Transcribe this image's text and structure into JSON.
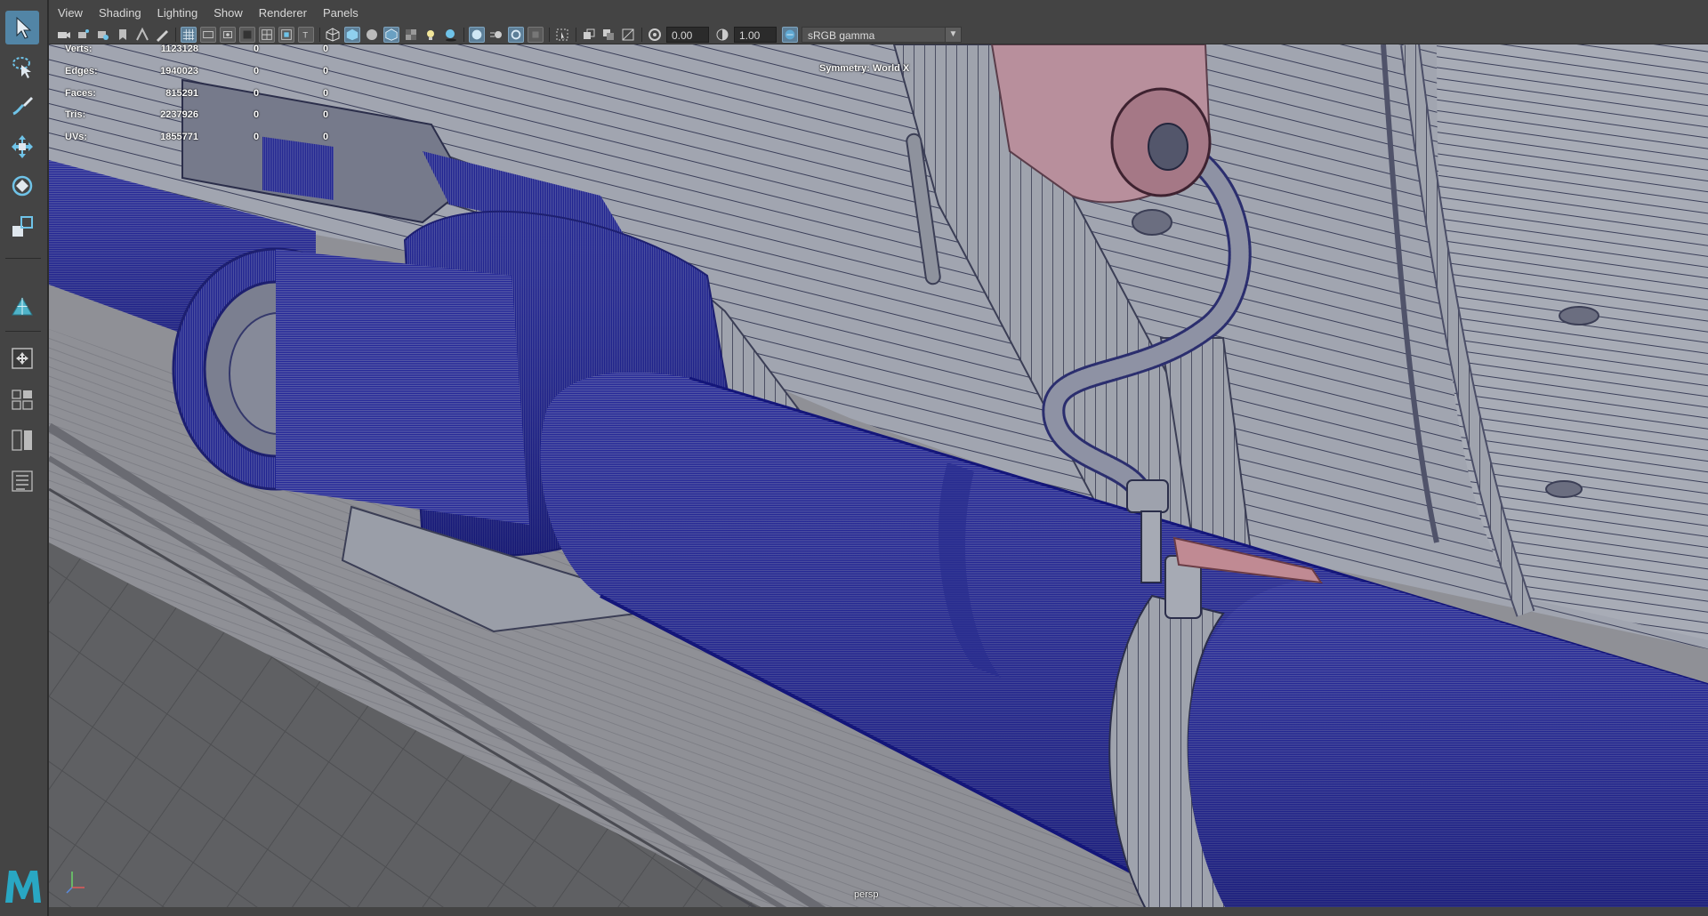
{
  "menubar": {
    "items": [
      "View",
      "Shading",
      "Lighting",
      "Show",
      "Renderer",
      "Panels"
    ]
  },
  "iconbar": {
    "exposure_value": "0.00",
    "gamma_value": "1.00",
    "color_space": "sRGB gamma"
  },
  "hud": {
    "stats": [
      {
        "label": "Verts:",
        "value": "1123128",
        "selected": "0",
        "components": "0"
      },
      {
        "label": "Edges:",
        "value": "1940023",
        "selected": "0",
        "components": "0"
      },
      {
        "label": "Faces:",
        "value": "815291",
        "selected": "0",
        "components": "0"
      },
      {
        "label": "Tris:",
        "value": "2237926",
        "selected": "0",
        "components": "0"
      },
      {
        "label": "UVs:",
        "value": "1855771",
        "selected": "0",
        "components": "0"
      }
    ],
    "symmetry": "Symmetry: World X",
    "camera": "persp"
  },
  "toolrail": {
    "tools": [
      "select-tool-icon",
      "lasso-tool-icon",
      "paint-select-icon",
      "move-tool-icon",
      "rotate-tool-icon",
      "scale-tool-icon",
      "soft-mod-icon",
      "show-manipulator-icon",
      "quick-layout-icon",
      "two-pane-icon",
      "outliner-icon"
    ]
  },
  "colors": {
    "ui_bg": "#444444",
    "viewport_bg": "#8f9096",
    "wireframe": "#1f1f8c",
    "active_tool": "#5285a6"
  }
}
